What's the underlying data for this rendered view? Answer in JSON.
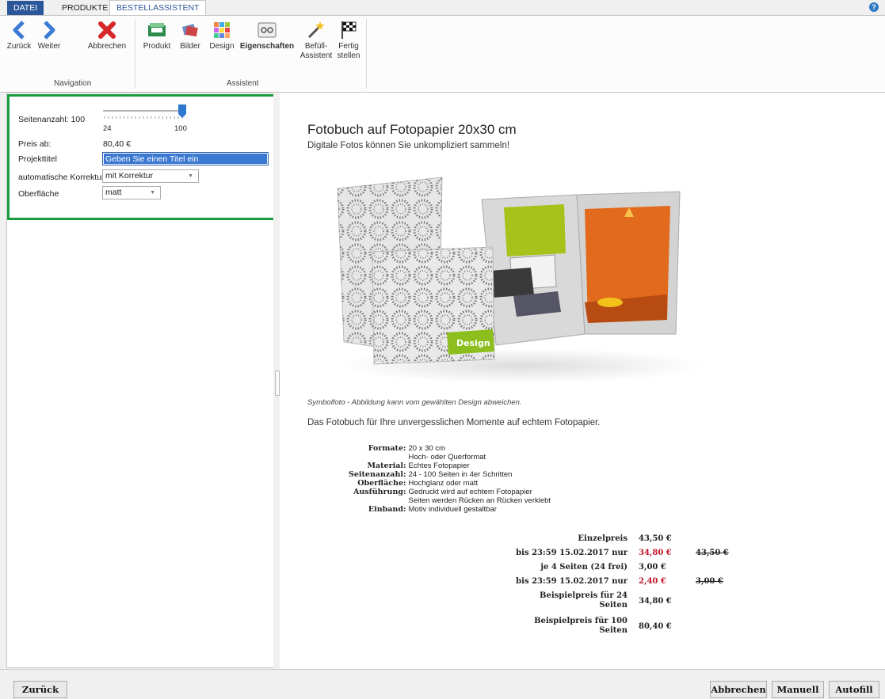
{
  "tabs": {
    "file": "DATEI",
    "products": "PRODUKTE",
    "assistant": "BESTELLASSISTENT"
  },
  "help_glyph": "?",
  "ribbon": {
    "back": "Zurück",
    "next": "Weiter",
    "cancel": "Abbrechen",
    "product": "Produkt",
    "images": "Bilder",
    "design": "Design",
    "properties": "Eigenschaften",
    "fill_l1": "Befüll-",
    "fill_l2": "Assistent",
    "finish_l1": "Fertig",
    "finish_l2": "stellen",
    "group_navigation": "Navigation",
    "group_assistant": "Assistent"
  },
  "settings": {
    "pages_label": "Seitenanzahl: 100",
    "pages_value": 100,
    "pages_min": "24",
    "pages_max": "100",
    "price_label": "Preis ab:",
    "price_value": "80,40 €",
    "title_label": "Projekttitel",
    "title_value": "Geben Sie einen Titel ein",
    "correction_label": "automatische Korrektur",
    "correction_value": "mit Korrektur",
    "surface_label": "Oberfläche",
    "surface_value": "matt"
  },
  "product": {
    "title": "Fotobuch auf Fotopapier 20x30 cm",
    "subtitle": "Digitale Fotos können Sie unkompliziert sammeln!",
    "badge": "Design",
    "caption": "Symbolfoto - Abbildung kann vom gewählten Design abweichen.",
    "intro": "Das Fotobuch für Ihre unvergesslichen Momente auf echtem Fotopapier.",
    "specs": [
      {
        "k": "Formate:",
        "v": "20 x 30 cm"
      },
      {
        "k": "",
        "v": "Hoch- oder Querformat"
      },
      {
        "k": "Material:",
        "v": "Echtes Fotopapier"
      },
      {
        "k": "Seitenanzahl:",
        "v": "24 - 100 Seiten in 4er Schritten"
      },
      {
        "k": "Oberfläche:",
        "v": "Hochglanz oder matt"
      },
      {
        "k": "Ausführung:",
        "v": "Gedruckt wird auf echtem Fotopapier"
      },
      {
        "k": "",
        "v": "Seiten werden Rücken an Rücken verklebt"
      },
      {
        "k": "Einband:",
        "v": "Motiv individuell gestaltbar"
      }
    ],
    "prices": [
      {
        "label": "Einzelpreis",
        "value": "43,50 €",
        "old": ""
      },
      {
        "label": "bis 23:59 15.02.2017 nur",
        "value": "34,80 €",
        "old": "43,50 €"
      },
      {
        "label": "je 4 Seiten (24 frei)",
        "value": "3,00 €",
        "old": ""
      },
      {
        "label": "bis 23:59 15.02.2017 nur",
        "value": "2,40 €",
        "old": "3,00 €"
      },
      {
        "label1": "Beispielpreis für 24",
        "label2": "Seiten",
        "value": "34,80 €"
      },
      {
        "label1": "Beispielpreis für 100",
        "label2": "Seiten",
        "value": "80,40 €"
      }
    ]
  },
  "bottom": {
    "back": "Zurück",
    "cancel": "Abbrechen",
    "manual": "Manuell",
    "autofill": "Autofill"
  },
  "colors": {
    "accent": "#2b579a",
    "highlight_border": "#1a9b3e",
    "sale_red": "#c0142a"
  }
}
